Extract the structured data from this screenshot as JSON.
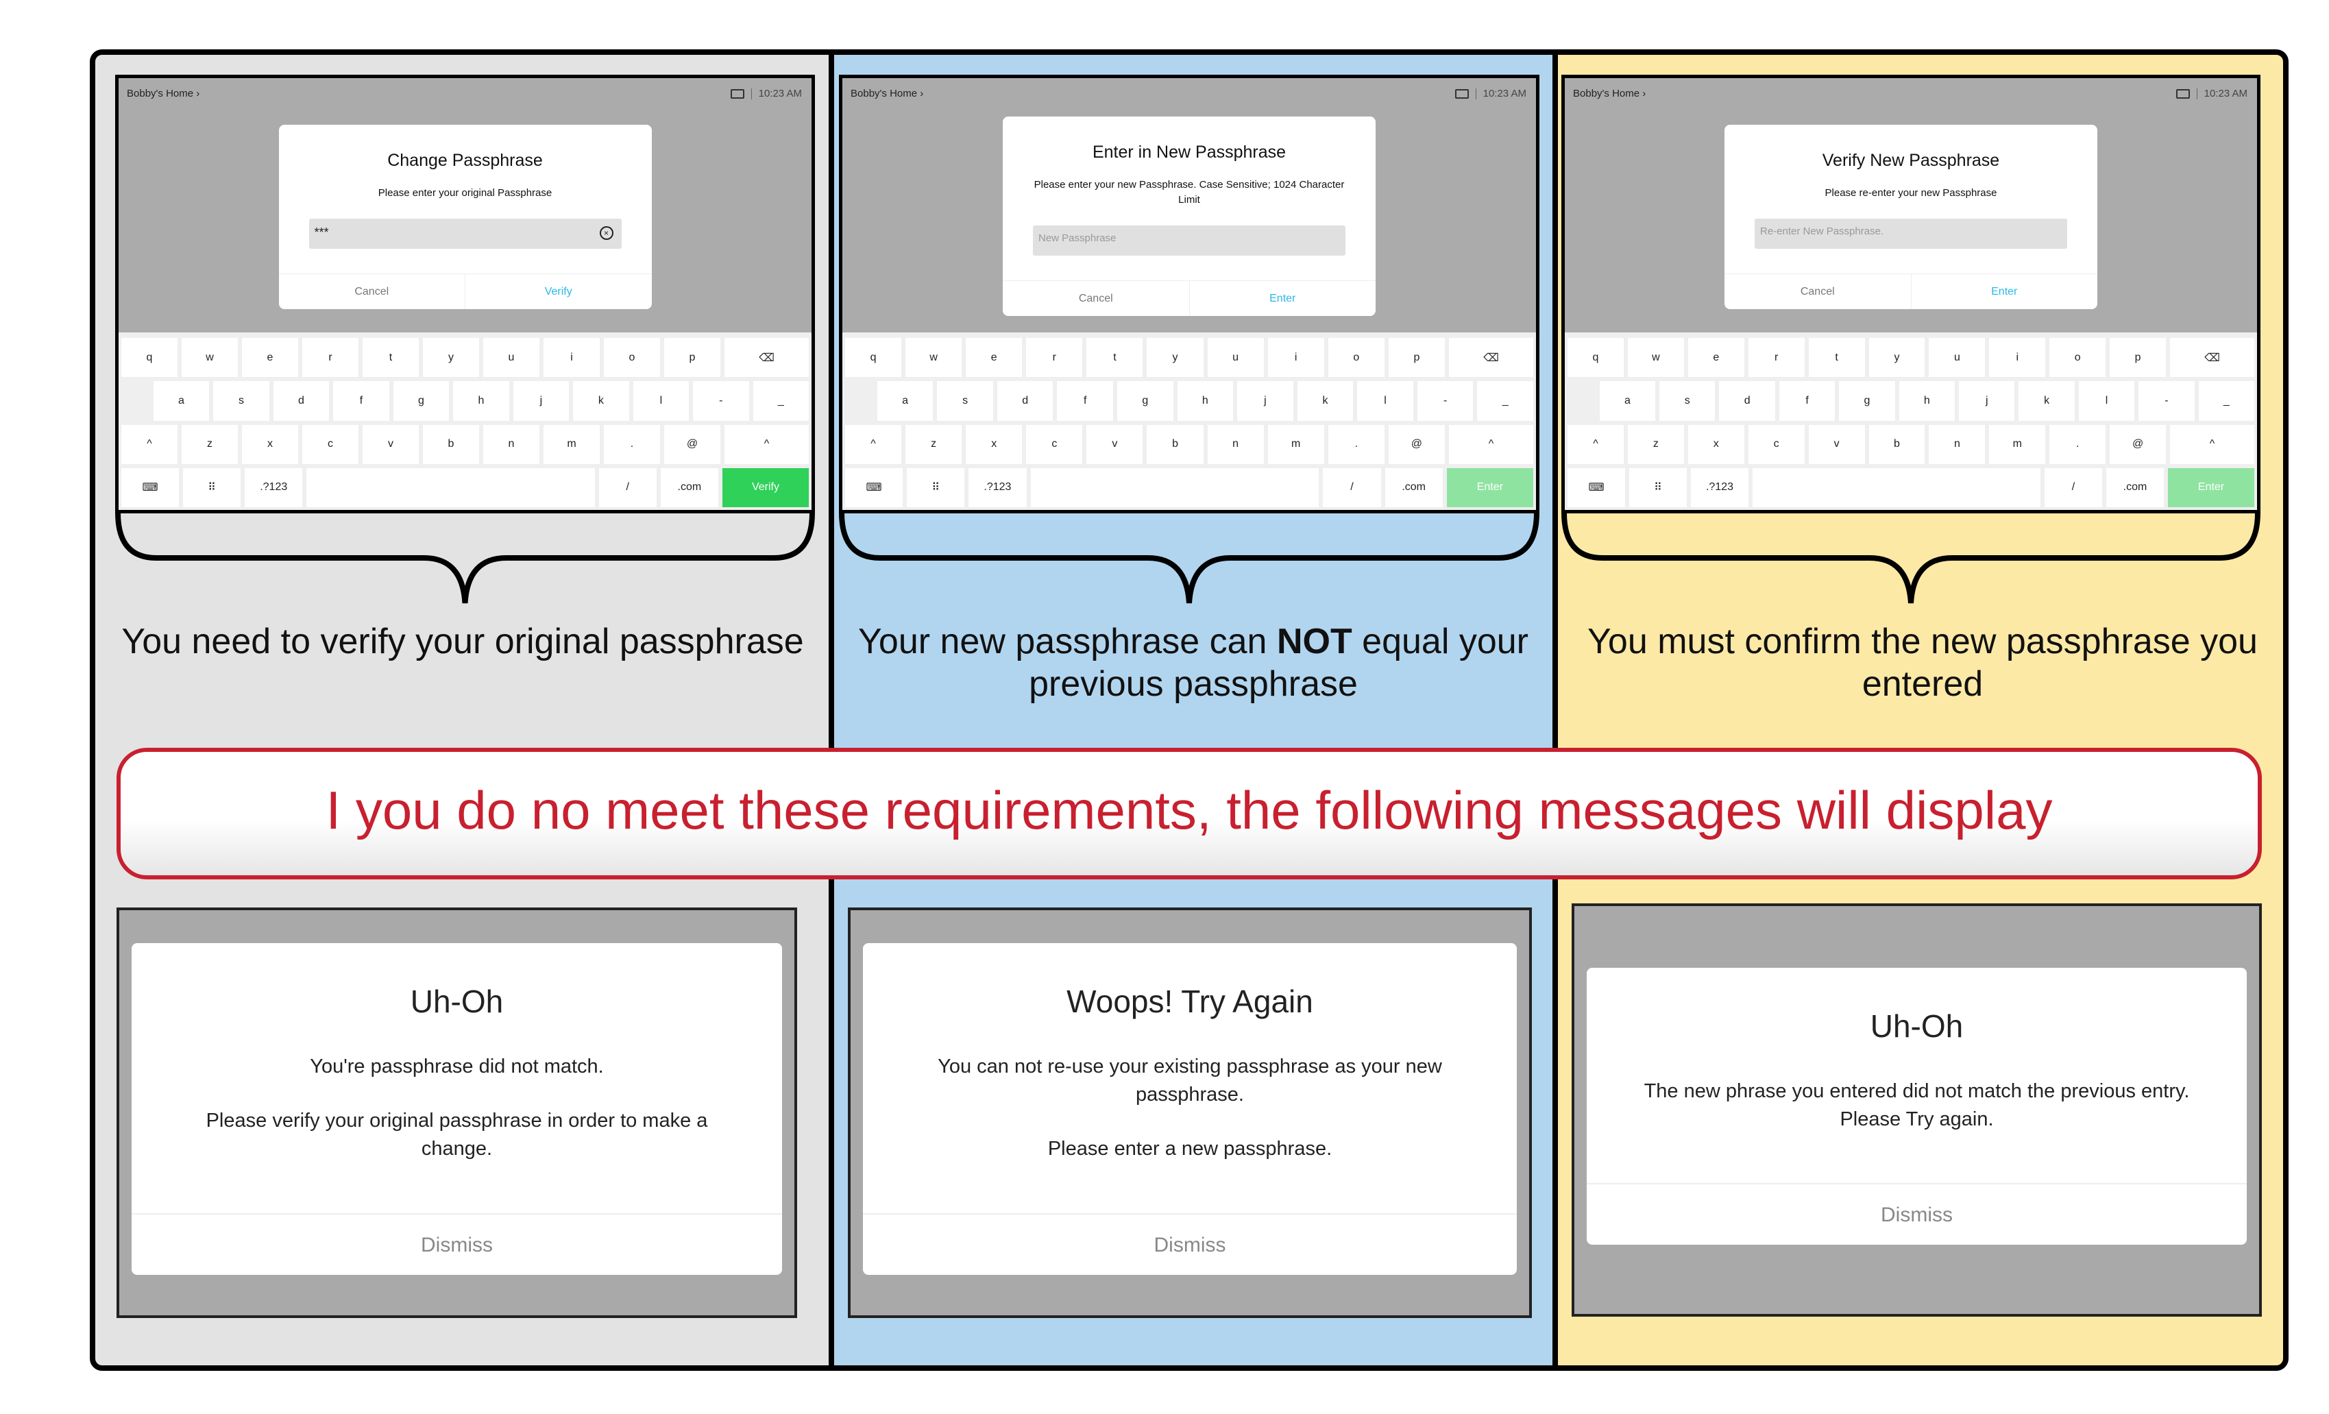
{
  "status": {
    "location": "Bobby's Home",
    "time": "10:23 AM"
  },
  "keyboard": {
    "row1": [
      "q",
      "w",
      "e",
      "r",
      "t",
      "y",
      "u",
      "i",
      "o",
      "p",
      "⌫"
    ],
    "row2": [
      "a",
      "s",
      "d",
      "f",
      "g",
      "h",
      "j",
      "k",
      "l",
      "-",
      "_"
    ],
    "row3": [
      "^",
      "z",
      "x",
      "c",
      "v",
      "b",
      "n",
      "m",
      ".",
      "@",
      "^"
    ],
    "row4": [
      "⌨",
      "⠿",
      ".?123",
      "",
      "/",
      ".com"
    ]
  },
  "screens": [
    {
      "title": "Change Passphrase",
      "subtitle": "Please enter your original Passphrase",
      "field_value": "***",
      "placeholder": "",
      "cancel": "Cancel",
      "confirm": "Verify",
      "action_key": "Verify",
      "action_color": "#2fd158",
      "caption": "You need to verify your original passphrase"
    },
    {
      "title": "Enter in New Passphrase",
      "subtitle": "Please enter your new Passphrase. Case Sensitive; 1024 Character Limit",
      "field_value": "",
      "placeholder": "New Passphrase",
      "cancel": "Cancel",
      "confirm": "Enter",
      "action_key": "Enter",
      "action_color": "#8fe3a0",
      "caption_pre": "Your new passphrase can ",
      "caption_bold": "NOT",
      "caption_post": " equal your previous passphrase"
    },
    {
      "title": "Verify New Passphrase",
      "subtitle": "Please re-enter your new Passphrase",
      "field_value": "",
      "placeholder": "Re-enter New Passphrase.",
      "cancel": "Cancel",
      "confirm": "Enter",
      "action_key": "Enter",
      "action_color": "#8fe3a0",
      "caption": "You must confirm the new passphrase you entered"
    }
  ],
  "banner": "I you do no meet these requirements, the following messages will display",
  "errors": [
    {
      "title": "Uh-Oh",
      "line1": "You're passphrase did not match.",
      "line2": "Please verify your original passphrase in order to make a change.",
      "dismiss": "Dismiss"
    },
    {
      "title": "Woops! Try Again",
      "line1": "You can not re-use your existing passphrase as your new passphrase.",
      "line2": "Please enter a new passphrase.",
      "dismiss": "Dismiss"
    },
    {
      "title": "Uh-Oh",
      "line1": "The new phrase you entered did not match the previous entry. Please Try again.",
      "dismiss": "Dismiss"
    }
  ],
  "colors": {
    "panel1": "#e3e3e3",
    "panel2": "#b1d5ef",
    "panel3": "#fde9a6",
    "banner_red": "#c8202f"
  }
}
